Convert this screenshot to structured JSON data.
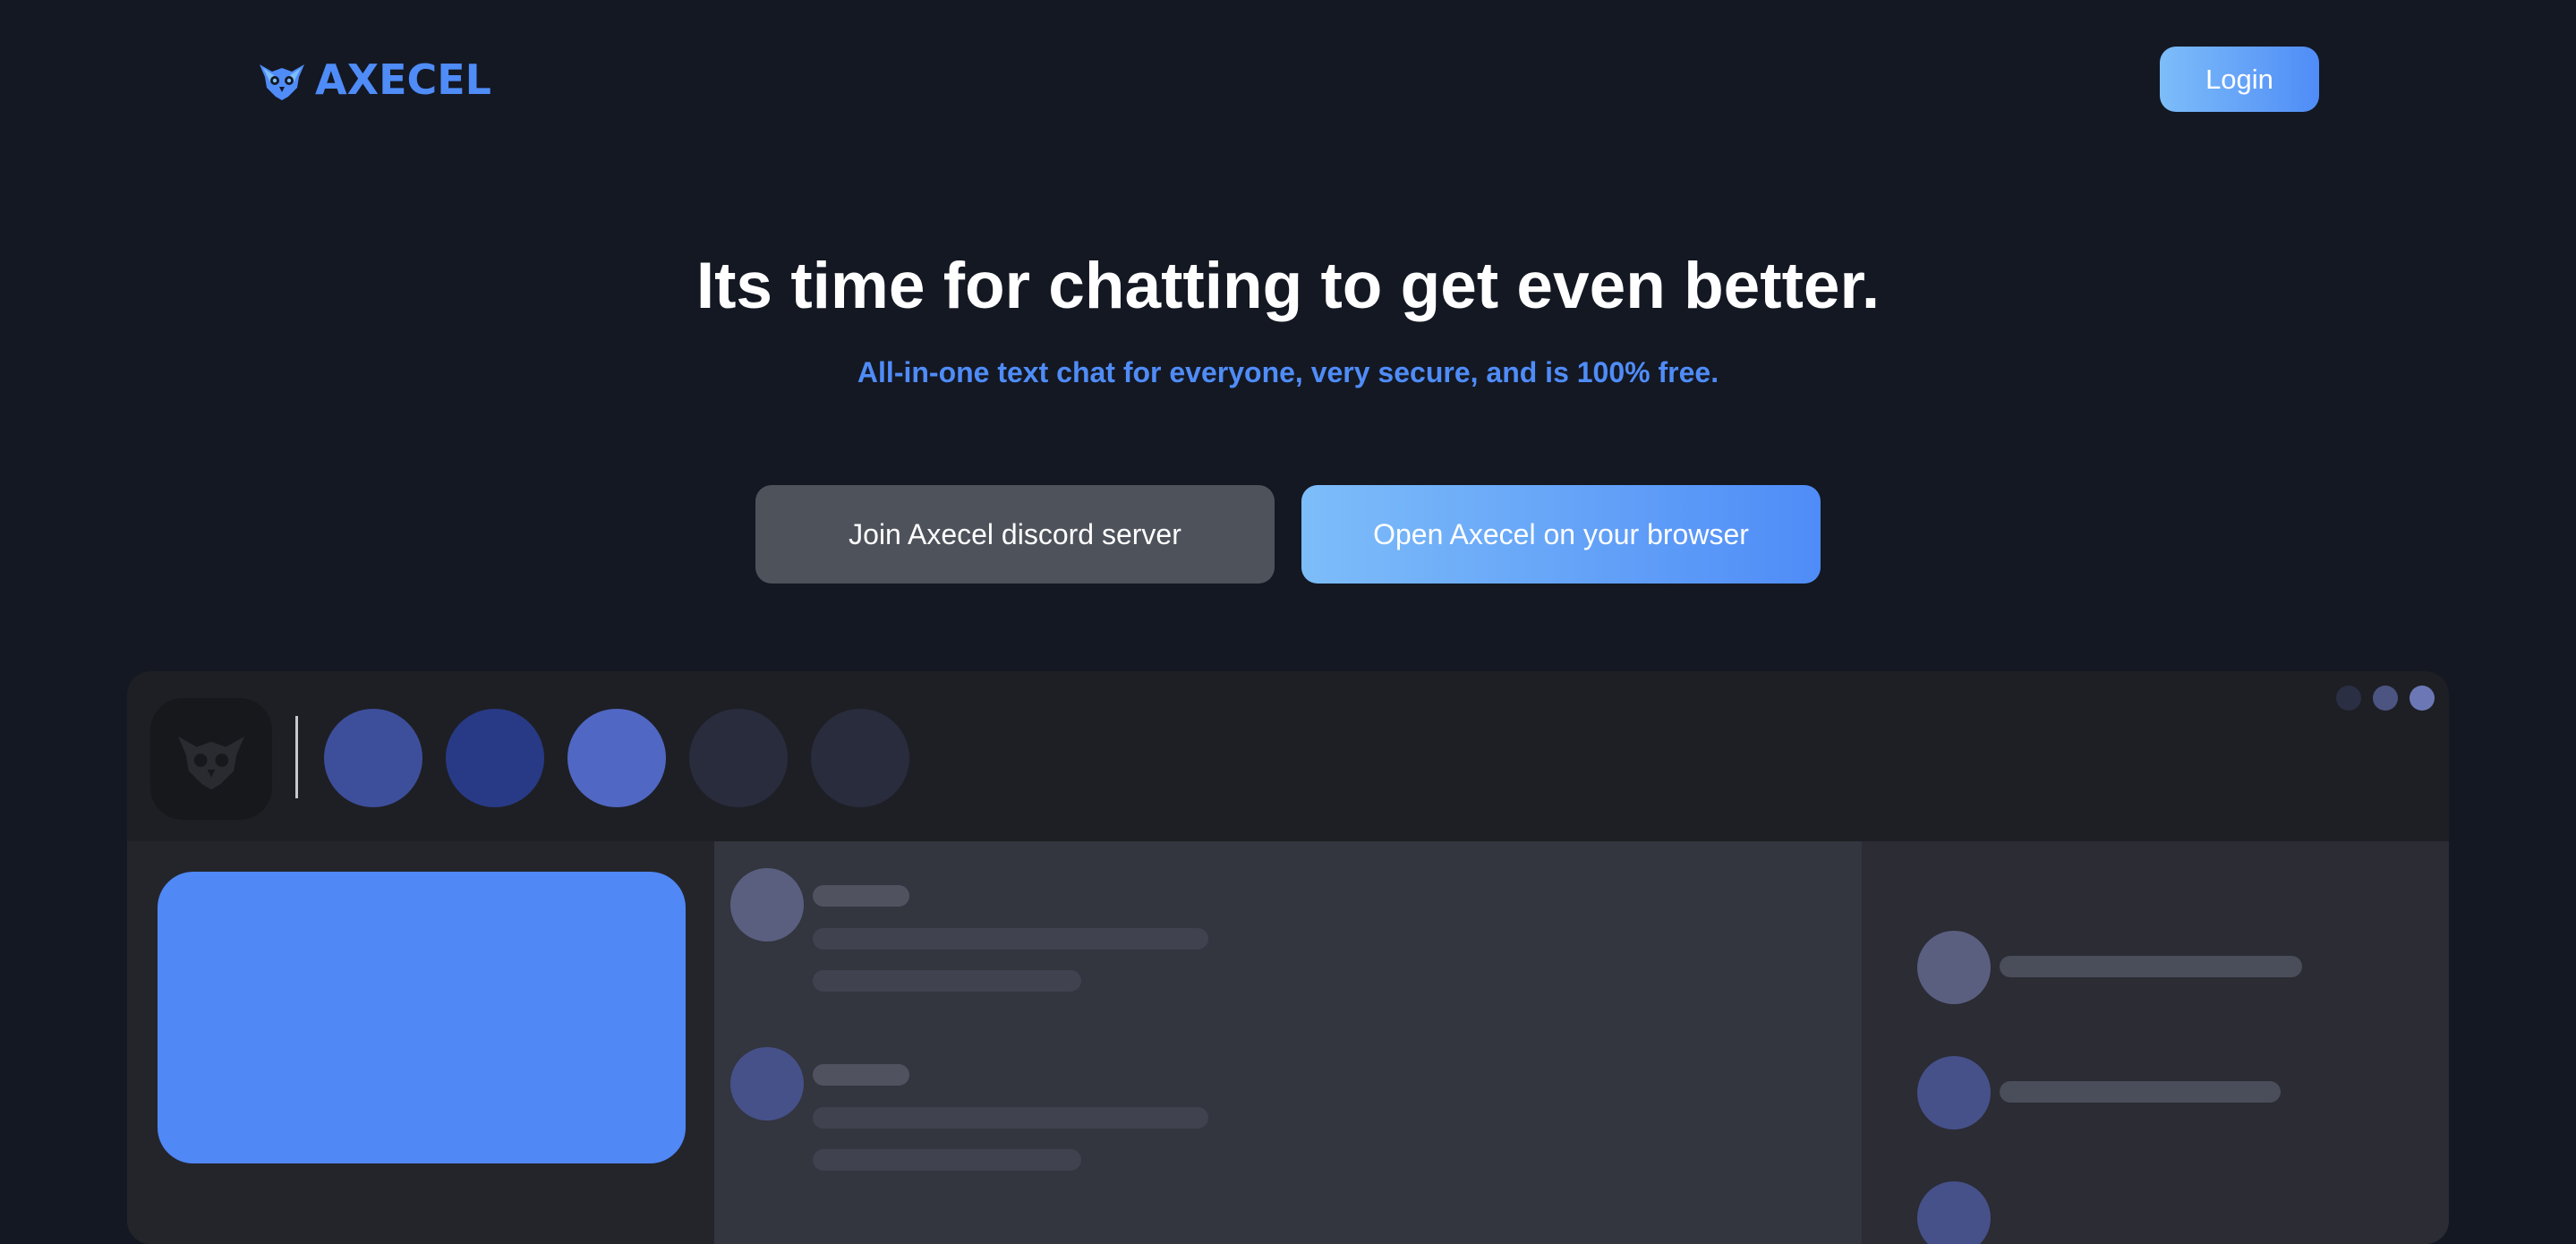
{
  "header": {
    "brand": "AXECEL",
    "login_label": "Login"
  },
  "hero": {
    "title": "Its time for chatting to get even better.",
    "subtitle": "All-in-one text chat for everyone, very secure, and is 100% free."
  },
  "actions": {
    "discord_label": "Join Axecel discord server",
    "browser_label": "Open Axecel on your browser"
  },
  "colors": {
    "background": "#141823",
    "accent": "#4f8cf7",
    "accent_light": "#7dbdf9",
    "button_gray": "#4e525b",
    "app_frame": "#1e1f24",
    "chat_panel": "#33353f",
    "member_panel": "#2b2c34"
  },
  "icons": {
    "brand": "owl-logo-icon",
    "server": "owl-server-icon"
  }
}
